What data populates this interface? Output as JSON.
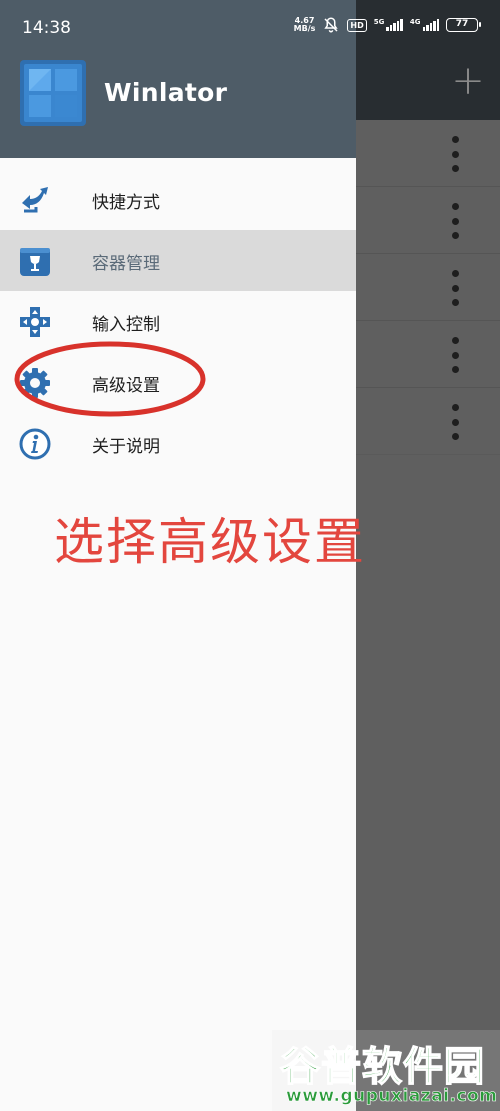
{
  "status_bar": {
    "time": "14:38",
    "speed_value": "4.67",
    "speed_unit": "MB/s",
    "hd_label": "HD",
    "network_1": "5G",
    "network_2": "4G",
    "battery": "77"
  },
  "drawer": {
    "app_title": "Winlator",
    "items": [
      {
        "label": "快捷方式",
        "icon": "shortcut-icon",
        "active": false
      },
      {
        "label": "容器管理",
        "icon": "container-icon",
        "active": true
      },
      {
        "label": "输入控制",
        "icon": "gamepad-dpad-icon",
        "active": false
      },
      {
        "label": "高级设置",
        "icon": "gear-icon",
        "active": false
      },
      {
        "label": "关于说明",
        "icon": "info-icon",
        "active": false
      }
    ]
  },
  "annotation": {
    "text": "选择高级设置",
    "color": "#e3463e"
  },
  "watermark": {
    "main": "谷普软件园",
    "url": "www.gupuxiazai.com"
  },
  "colors": {
    "header": "#4e5c67",
    "accent": "#2f6fb0",
    "active_item": "#dadada"
  }
}
